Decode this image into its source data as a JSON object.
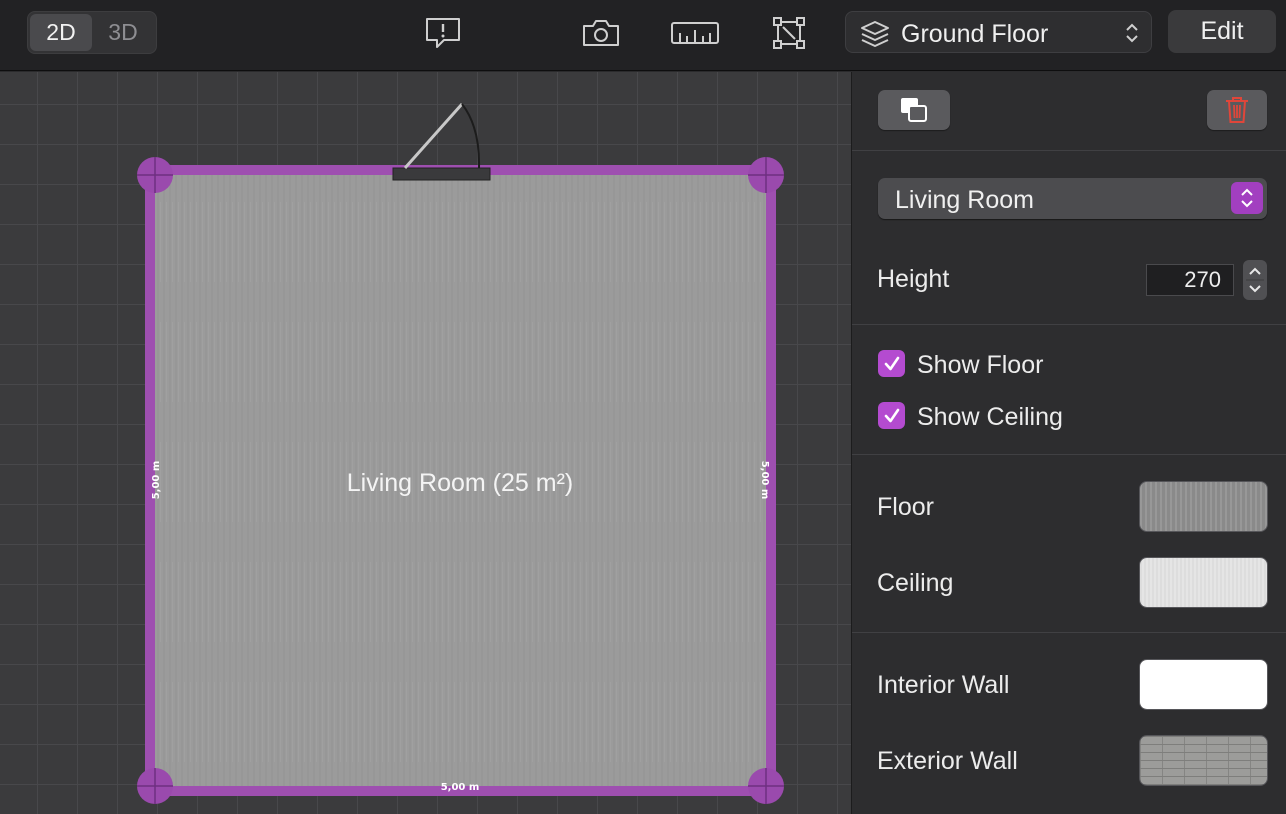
{
  "toolbar": {
    "view_modes": [
      "2D",
      "3D"
    ],
    "active_view": "2D",
    "icons": [
      "feedback-icon",
      "camera-icon",
      "ruler-icon",
      "transform-icon"
    ],
    "floor_select": {
      "label": "Ground Floor"
    },
    "edit_label": "Edit"
  },
  "canvas": {
    "room_label": "Living Room (25 m²)",
    "dimensions": {
      "left": "5,00 m",
      "right": "5,00 m",
      "bottom": "5,00 m"
    },
    "colors": {
      "wall": "#9e4fb0",
      "floor": "#9b9b9b",
      "handle": "#9a4aad"
    }
  },
  "inspector": {
    "buttons": {
      "duplicate_icon": "duplicate-icon",
      "delete_icon": "trash-icon"
    },
    "room_select": {
      "value": "Living Room"
    },
    "height": {
      "label": "Height",
      "value": "270"
    },
    "show_floor": {
      "label": "Show Floor",
      "checked": true
    },
    "show_ceiling": {
      "label": "Show Ceiling",
      "checked": true
    },
    "materials": {
      "floor": "Floor",
      "ceiling": "Ceiling",
      "interior_wall": "Interior Wall",
      "exterior_wall": "Exterior Wall"
    },
    "accent_color": "#b44bd0",
    "delete_color": "#e0463a"
  }
}
